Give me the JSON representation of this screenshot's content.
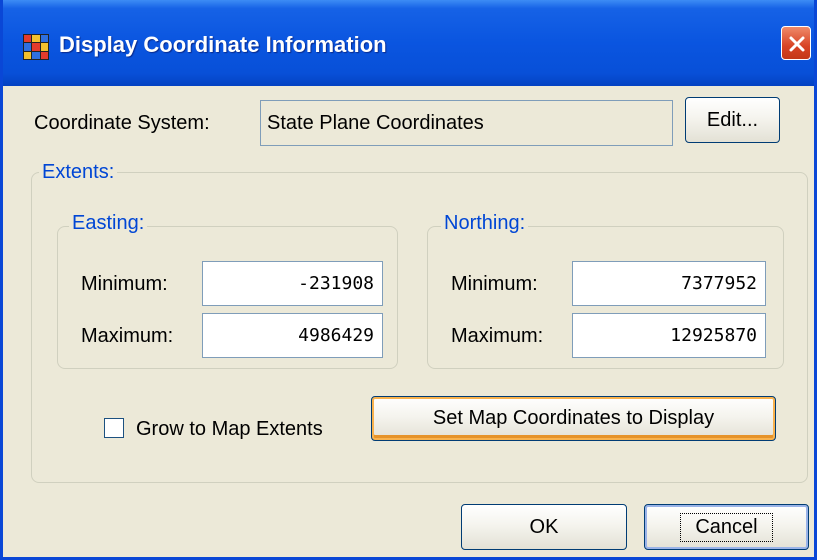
{
  "window": {
    "title": "Display Coordinate Information",
    "app_icon": "grid-app-icon",
    "close_icon": "close-icon"
  },
  "coordinate_system": {
    "label": "Coordinate System:",
    "value": "State Plane Coordinates",
    "edit_label": "Edit..."
  },
  "extents": {
    "title": "Extents:",
    "easting": {
      "title": "Easting:",
      "min_label": "Minimum:",
      "min_value": "-231908",
      "max_label": "Maximum:",
      "max_value": "4986429"
    },
    "northing": {
      "title": "Northing:",
      "min_label": "Minimum:",
      "min_value": "7377952",
      "max_label": "Maximum:",
      "max_value": "12925870"
    },
    "grow_checkbox": {
      "label": "Grow to Map Extents",
      "checked": false
    },
    "set_map_button": "Set Map Coordinates to Display"
  },
  "buttons": {
    "ok": "OK",
    "cancel": "Cancel"
  },
  "colors": {
    "titlebar": "#0a55e0",
    "dialog_bg": "#ece9d8",
    "group_title": "#0046d5",
    "close_button": "#d84324"
  }
}
